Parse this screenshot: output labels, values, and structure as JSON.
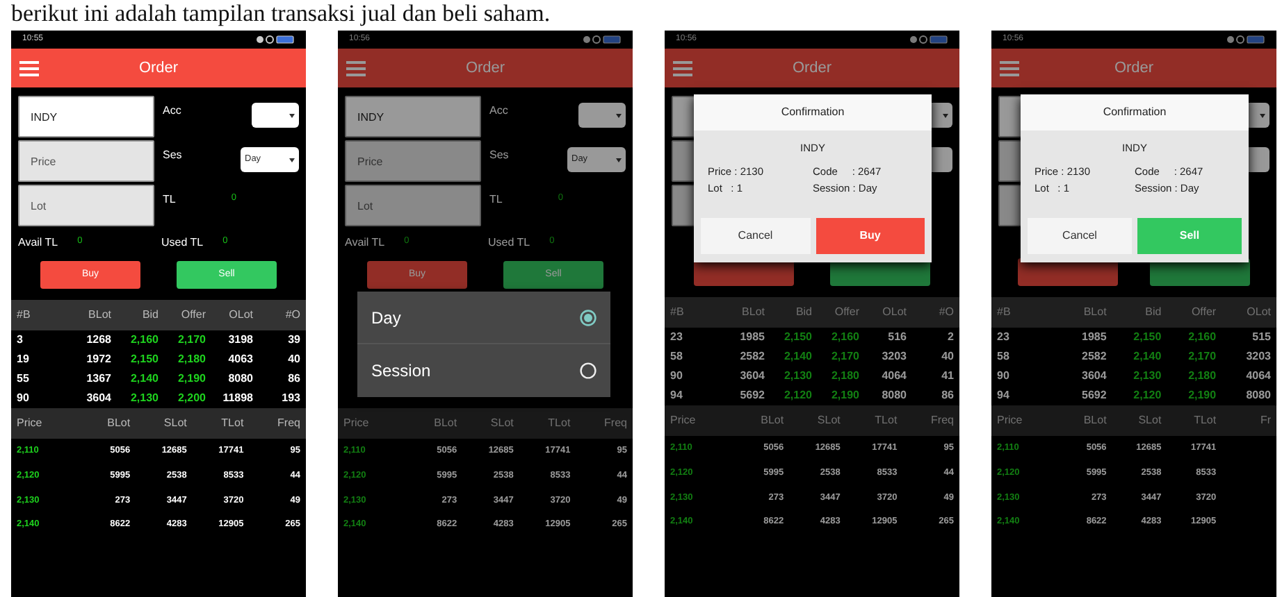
{
  "caption": "berikut ini adalah tampilan transaksi jual dan beli saham.",
  "phones": [
    {
      "time": "10:55",
      "title": "Order",
      "dimmed": false,
      "form": {
        "symbol": "INDY",
        "price_placeholder": "Price",
        "lot_placeholder": "Lot",
        "acc_label": "Acc",
        "ses_label": "Ses",
        "session": "Day",
        "tl_label": "TL",
        "tl_value": "0",
        "avail_label": "Avail TL",
        "avail_value": "0",
        "used_label": "Used TL",
        "used_value": "0"
      },
      "buy": "Buy",
      "sell": "Sell",
      "orderbook": {
        "columns": [
          {
            "label": "#B",
            "kind": "count"
          },
          {
            "label": "BLot",
            "kind": "number"
          },
          {
            "label": "Bid",
            "kind": "price"
          },
          {
            "label": "Offer",
            "kind": "price"
          },
          {
            "label": "OLot",
            "kind": "number"
          },
          {
            "label": "#O",
            "kind": "number"
          }
        ],
        "rows": [
          [
            "3",
            "1268",
            "2,160",
            "2,170",
            "3198",
            "39"
          ],
          [
            "19",
            "1972",
            "2,150",
            "2,180",
            "4063",
            "40"
          ],
          [
            "55",
            "1367",
            "2,140",
            "2,190",
            "8080",
            "86"
          ],
          [
            "90",
            "3604",
            "2,130",
            "2,200",
            "11898",
            "193"
          ]
        ]
      },
      "trades": {
        "columns": [
          {
            "label": "Price",
            "kind": "price"
          },
          {
            "label": "BLot",
            "kind": "number"
          },
          {
            "label": "SLot",
            "kind": "number"
          },
          {
            "label": "TLot",
            "kind": "number"
          },
          {
            "label": "Freq",
            "kind": "number"
          }
        ],
        "rows": [
          [
            "2,110",
            "5056",
            "12685",
            "17741",
            "95"
          ],
          [
            "2,120",
            "5995",
            "2538",
            "8533",
            "44"
          ],
          [
            "2,130",
            "273",
            "3447",
            "3720",
            "49"
          ],
          [
            "2,140",
            "8622",
            "4283",
            "12905",
            "265"
          ]
        ]
      }
    },
    {
      "time": "10:56",
      "title": "Order",
      "dimmed": true,
      "form": {
        "symbol": "INDY",
        "price_placeholder": "Price",
        "lot_placeholder": "Lot",
        "acc_label": "Acc",
        "ses_label": "Ses",
        "session": "Day",
        "tl_label": "TL",
        "tl_value": "0",
        "avail_label": "Avail TL",
        "avail_value": "0",
        "used_label": "Used TL",
        "used_value": "0"
      },
      "buy": "Buy",
      "sell": "Sell",
      "menu": [
        {
          "label": "Day",
          "selected": true
        },
        {
          "label": "Session",
          "selected": false
        }
      ],
      "trades": {
        "columns": [
          {
            "label": "Price",
            "kind": "price"
          },
          {
            "label": "BLot",
            "kind": "number"
          },
          {
            "label": "SLot",
            "kind": "number"
          },
          {
            "label": "TLot",
            "kind": "number"
          },
          {
            "label": "Freq",
            "kind": "number"
          }
        ],
        "rows": [
          [
            "2,110",
            "5056",
            "12685",
            "17741",
            "95"
          ],
          [
            "2,120",
            "5995",
            "2538",
            "8533",
            "44"
          ],
          [
            "2,130",
            "273",
            "3447",
            "3720",
            "49"
          ],
          [
            "2,140",
            "8622",
            "4283",
            "12905",
            "265"
          ]
        ]
      }
    },
    {
      "time": "10:56",
      "title": "Order",
      "dimmed": true,
      "dialog": {
        "title": "Confirmation",
        "symbol": "INDY",
        "lines_left": [
          "Price : 2130",
          "Lot   : 1"
        ],
        "lines_right": [
          "Code     : 2647",
          "Session : Day"
        ],
        "cancel": "Cancel",
        "confirm": "Buy",
        "kind": "buy"
      },
      "orderbook": {
        "columns": [
          {
            "label": "#B",
            "kind": "count"
          },
          {
            "label": "BLot",
            "kind": "number"
          },
          {
            "label": "Bid",
            "kind": "price"
          },
          {
            "label": "Offer",
            "kind": "price"
          },
          {
            "label": "OLot",
            "kind": "number"
          },
          {
            "label": "#O",
            "kind": "number"
          }
        ],
        "rows": [
          [
            "23",
            "1985",
            "2,150",
            "2,160",
            "516",
            "2"
          ],
          [
            "58",
            "2582",
            "2,140",
            "2,170",
            "3203",
            "40"
          ],
          [
            "90",
            "3604",
            "2,130",
            "2,180",
            "4064",
            "41"
          ],
          [
            "94",
            "5692",
            "2,120",
            "2,190",
            "8080",
            "86"
          ]
        ]
      },
      "trades": {
        "columns": [
          {
            "label": "Price",
            "kind": "price"
          },
          {
            "label": "BLot",
            "kind": "number"
          },
          {
            "label": "SLot",
            "kind": "number"
          },
          {
            "label": "TLot",
            "kind": "number"
          },
          {
            "label": "Freq",
            "kind": "number"
          }
        ],
        "rows": [
          [
            "2,110",
            "5056",
            "12685",
            "17741",
            "95"
          ],
          [
            "2,120",
            "5995",
            "2538",
            "8533",
            "44"
          ],
          [
            "2,130",
            "273",
            "3447",
            "3720",
            "49"
          ],
          [
            "2,140",
            "8622",
            "4283",
            "12905",
            "265"
          ]
        ]
      }
    },
    {
      "time": "10:56",
      "title": "Order",
      "dimmed": true,
      "dialog": {
        "title": "Confirmation",
        "symbol": "INDY",
        "lines_left": [
          "Price : 2130",
          "Lot   : 1"
        ],
        "lines_right": [
          "Code     : 2647",
          "Session : Day"
        ],
        "cancel": "Cancel",
        "confirm": "Sell",
        "kind": "sell"
      },
      "orderbook": {
        "columns": [
          {
            "label": "#B",
            "kind": "count"
          },
          {
            "label": "BLot",
            "kind": "number"
          },
          {
            "label": "Bid",
            "kind": "price"
          },
          {
            "label": "Offer",
            "kind": "price"
          },
          {
            "label": "OLot",
            "kind": "number"
          }
        ],
        "rows": [
          [
            "23",
            "1985",
            "2,150",
            "2,160",
            "515"
          ],
          [
            "58",
            "2582",
            "2,140",
            "2,170",
            "3203"
          ],
          [
            "90",
            "3604",
            "2,130",
            "2,180",
            "4064"
          ],
          [
            "94",
            "5692",
            "2,120",
            "2,190",
            "8080"
          ]
        ]
      },
      "trades": {
        "columns": [
          {
            "label": "Price",
            "kind": "price"
          },
          {
            "label": "BLot",
            "kind": "number"
          },
          {
            "label": "SLot",
            "kind": "number"
          },
          {
            "label": "TLot",
            "kind": "number"
          },
          {
            "label": "Fr",
            "kind": "number"
          }
        ],
        "rows": [
          [
            "2,110",
            "5056",
            "12685",
            "17741"
          ],
          [
            "2,120",
            "5995",
            "2538",
            "8533"
          ],
          [
            "2,130",
            "273",
            "3447",
            "3720"
          ],
          [
            "2,140",
            "8622",
            "4283",
            "12905"
          ]
        ]
      }
    }
  ]
}
